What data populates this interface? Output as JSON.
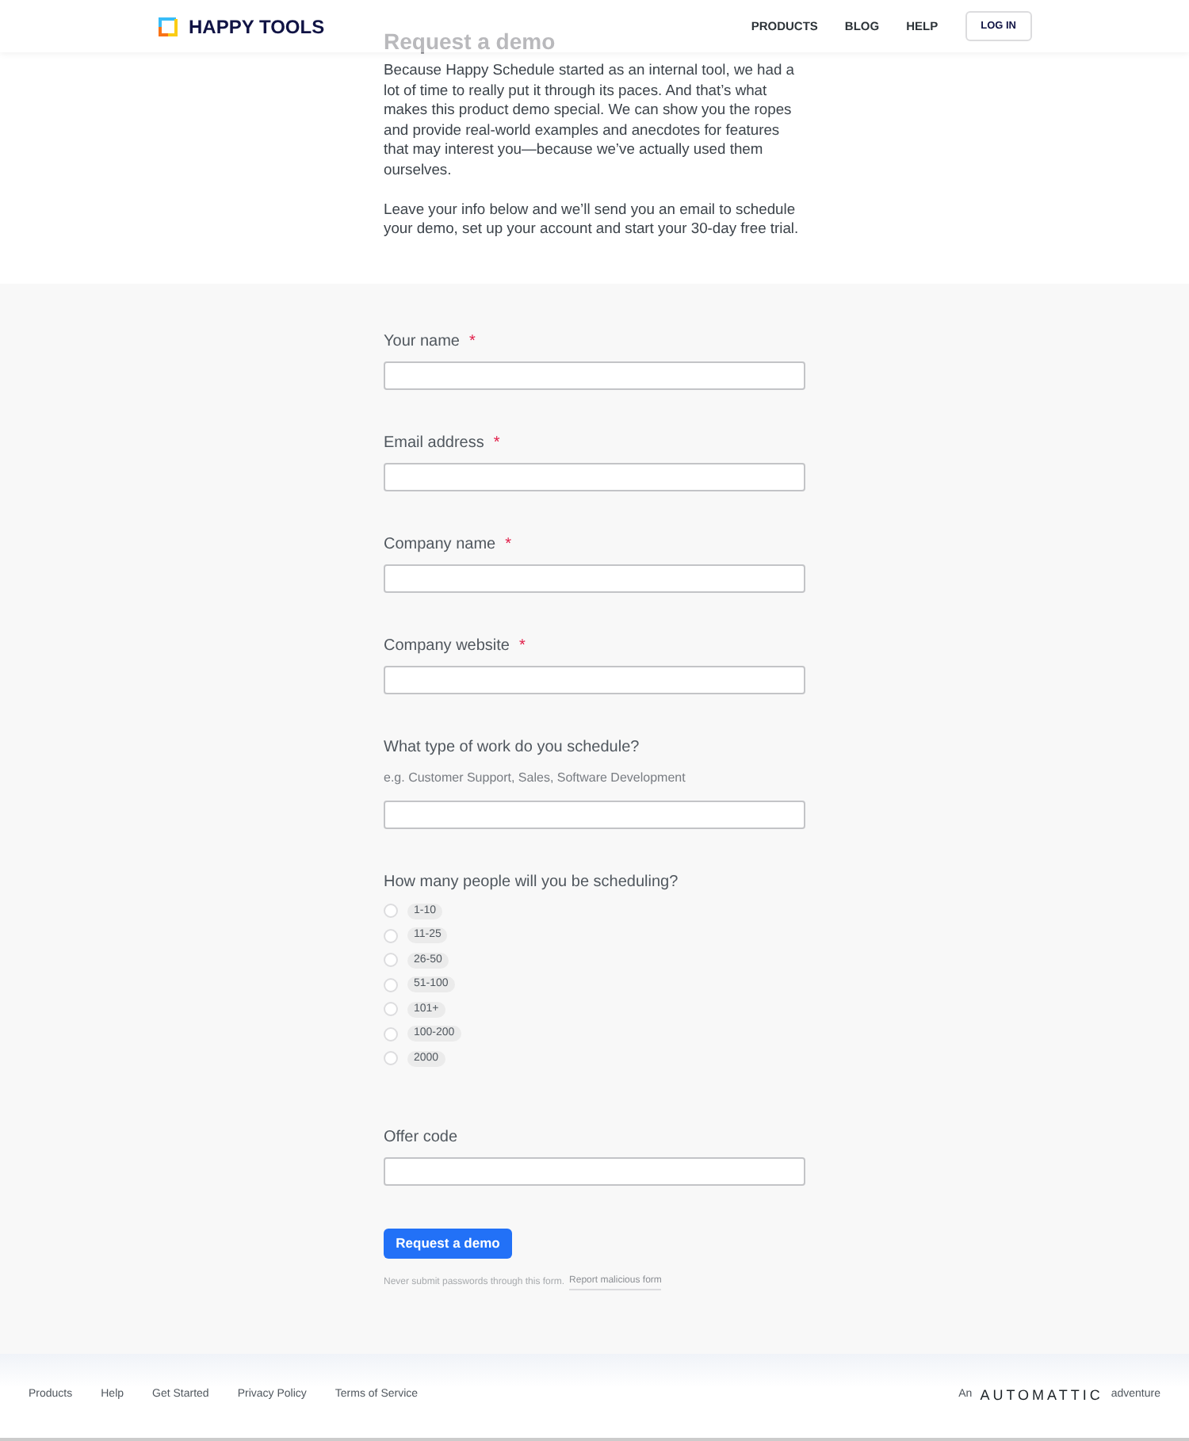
{
  "header": {
    "logo": "HAPPY TOOLS",
    "nav": [
      "PRODUCTS",
      "BLOG",
      "HELP"
    ],
    "login": "LOG IN"
  },
  "intro": {
    "heading": "Request a demo",
    "paragraphs": [
      "Because Happy Schedule started as an internal tool, we had a lot of time to really put it through its paces. And that’s what makes this product demo special. We can show you the ropes and provide real-world examples and anecdotes for features that may interest you—because we’ve actually used them ourselves.",
      "Leave your info below and we’ll send you an email to schedule your demo, set up your account and start your 30-day free trial."
    ]
  },
  "form": {
    "fields": [
      {
        "kind": "text",
        "label": "Your name",
        "required": true
      },
      {
        "kind": "text",
        "label": "Email address",
        "required": true
      },
      {
        "kind": "text",
        "label": "Company name",
        "required": true
      },
      {
        "kind": "text",
        "label": "Company website",
        "required": true
      },
      {
        "kind": "text",
        "label": "What type of work do you schedule?",
        "required": false,
        "hint": "e.g. Customer Support, Sales, Software Development"
      },
      {
        "kind": "radio",
        "label": "How many people will you be scheduling?",
        "required": false,
        "options": [
          {
            "label": "1-10",
            "selected": false
          },
          {
            "label": "11-25",
            "selected": false
          },
          {
            "label": "26-50",
            "selected": false
          },
          {
            "label": "51-100",
            "selected": false
          },
          {
            "label": "101+",
            "selected": false
          },
          {
            "label": "100-200",
            "selected": false
          },
          {
            "label": "2000",
            "selected": false
          }
        ]
      },
      {
        "kind": "text",
        "label": "Offer code",
        "required": false
      }
    ],
    "required_mark": "*",
    "submit": "Request a demo",
    "note": "Never submit passwords through this form.",
    "report_link": "Report malicious form"
  },
  "footer": {
    "links": [
      "Products",
      "Help",
      "Get Started",
      "Privacy Policy",
      "Terms of Service"
    ],
    "credit_prefix": "An",
    "credit_brand": "AUTOMATTIC",
    "credit_suffix": "adventure"
  }
}
